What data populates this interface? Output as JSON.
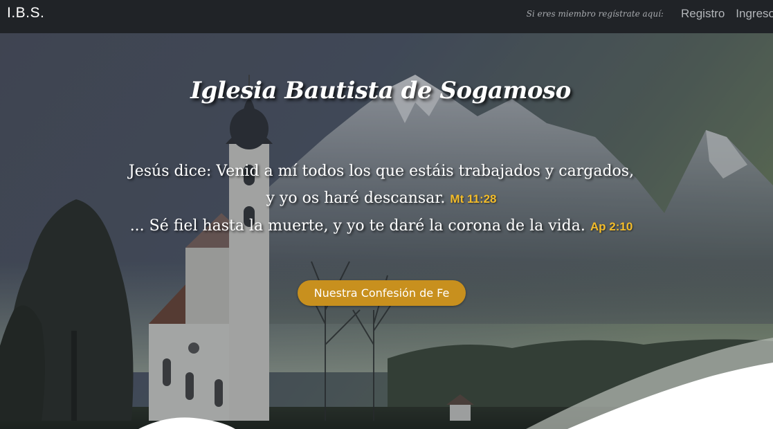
{
  "navbar": {
    "brand": "I.B.S.",
    "member_prompt": "Si eres miembro regístrate aquí:",
    "register_label": "Registro",
    "login_label": "Ingreso"
  },
  "hero": {
    "title": "Iglesia Bautista de Sogamoso",
    "verse_1_line_1": "Jesús dice: Venid a mí todos los que estáis trabajados y cargados,",
    "verse_1_line_2": "y yo os haré descansar.",
    "verse_1_ref": "Mt 11:28",
    "verse_2": "... Sé fiel hasta la muerte, y yo te daré la corona de la vida.",
    "verse_2_ref": "Ap 2:10",
    "cta_label": "Nuestra Confesión de Fe"
  },
  "colors": {
    "navbar_bg": "#202327",
    "reference_gold": "#f3bc2a",
    "button_gold": "#c8901e"
  }
}
